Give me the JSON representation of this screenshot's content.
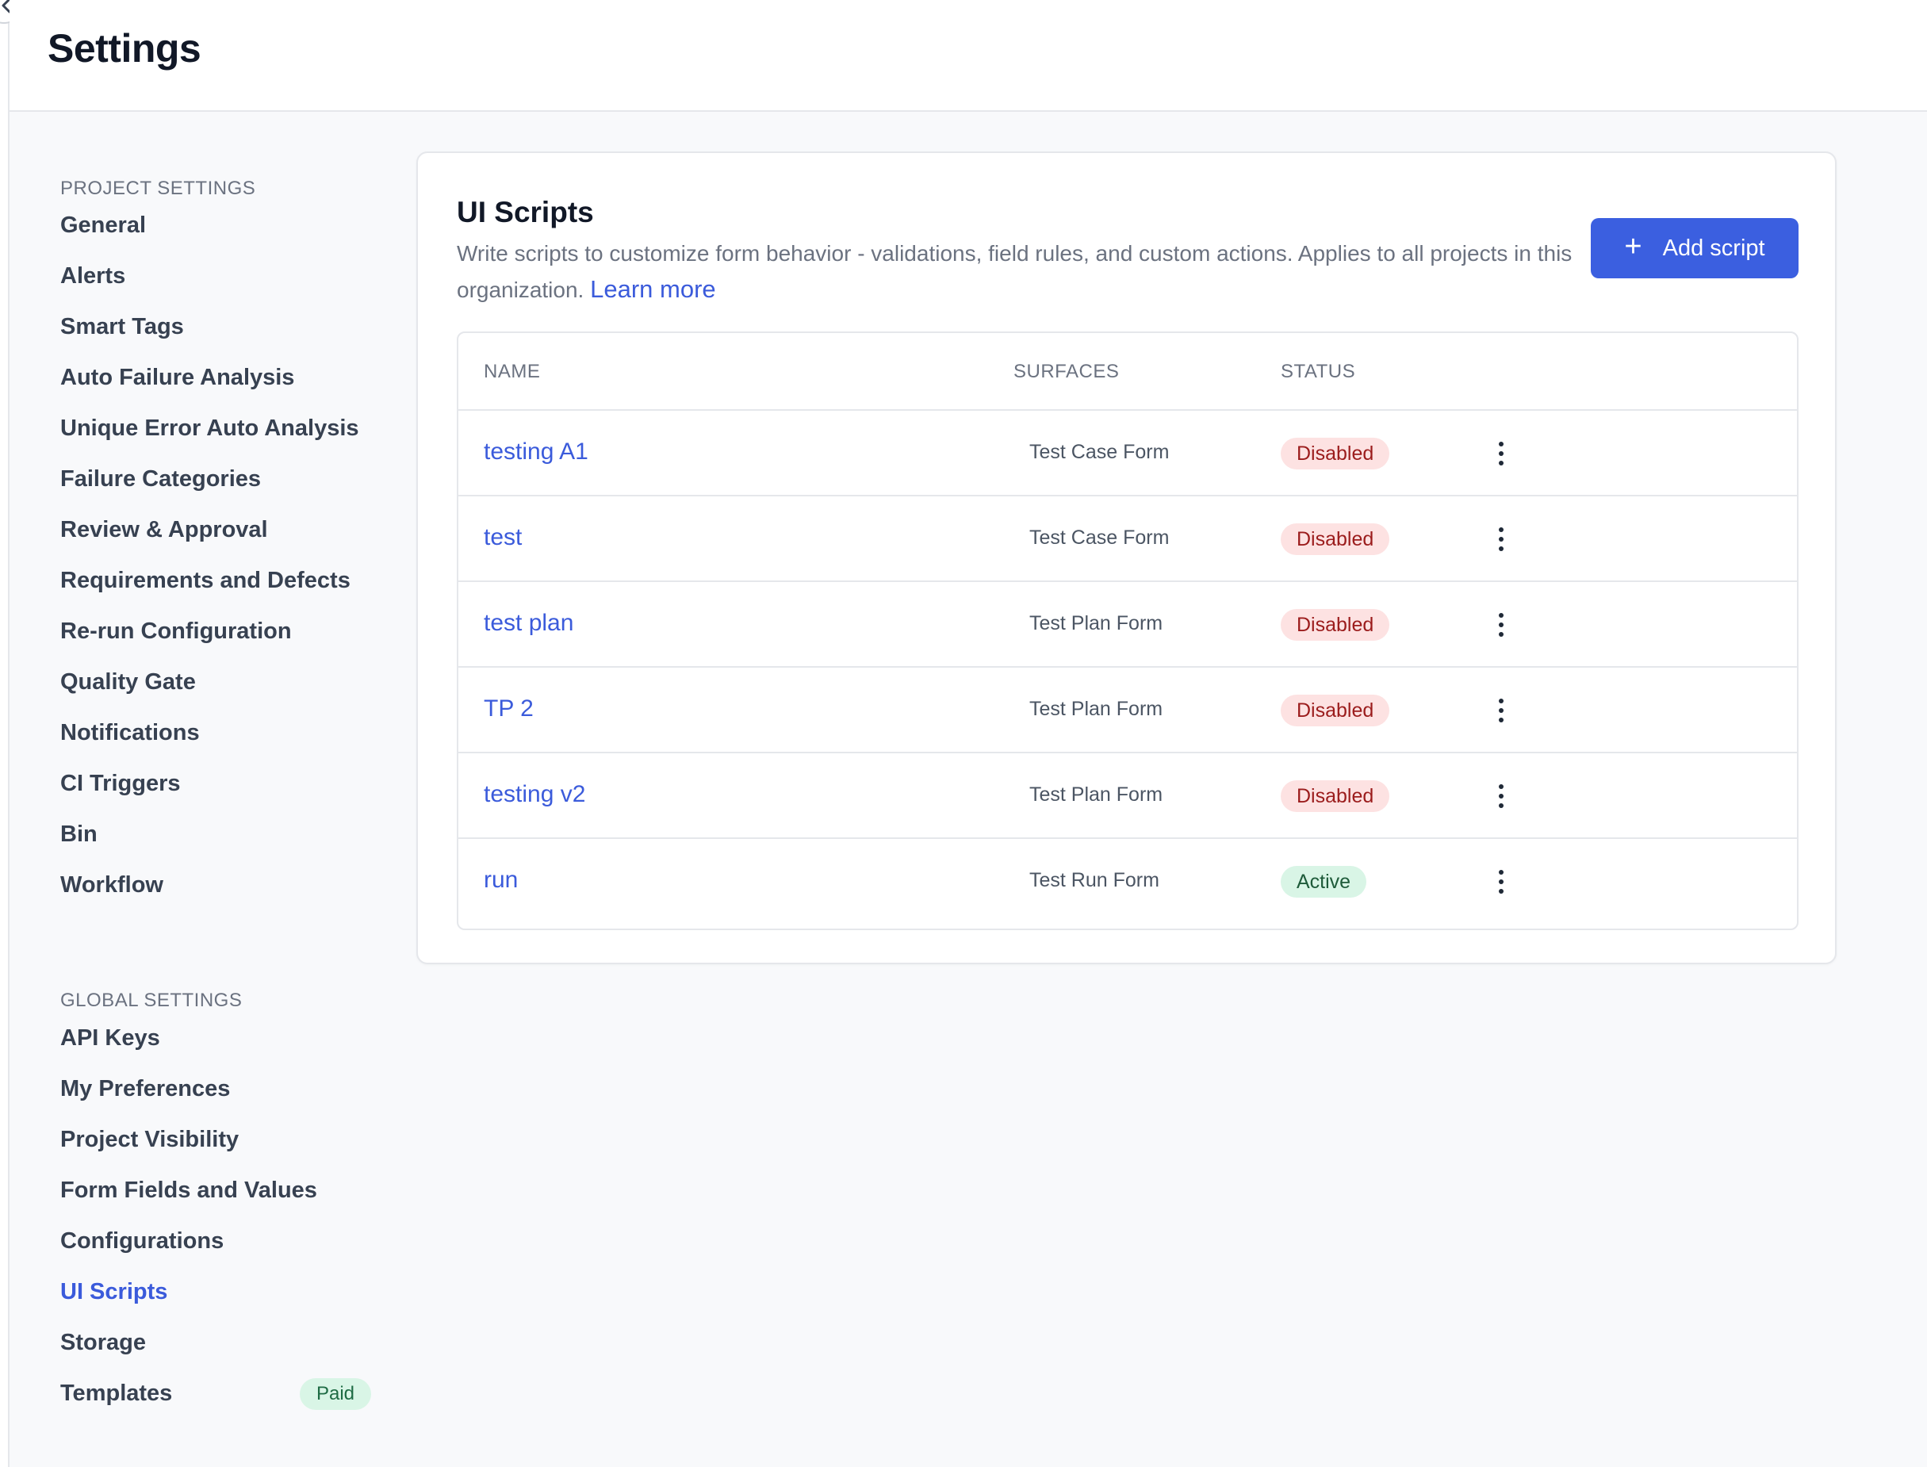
{
  "header": {
    "title": "Settings"
  },
  "sidebar": {
    "project_heading": "PROJECT SETTINGS",
    "project_items": [
      "General",
      "Alerts",
      "Smart Tags",
      "Auto Failure Analysis",
      "Unique Error Auto Analysis",
      "Failure Categories",
      "Review & Approval",
      "Requirements and Defects",
      "Re-run Configuration",
      "Quality Gate",
      "Notifications",
      "CI Triggers",
      "Bin",
      "Workflow"
    ],
    "global_heading": "GLOBAL SETTINGS",
    "global_items": [
      "API Keys",
      "My Preferences",
      "Project Visibility",
      "Form Fields and Values",
      "Configurations",
      "UI Scripts",
      "Storage",
      "Templates"
    ],
    "active_item": "UI Scripts",
    "templates_badge": "Paid"
  },
  "main": {
    "title": "UI Scripts",
    "description": "Write scripts to customize form behavior - validations, field rules, and custom actions. Applies to all projects in this organization.",
    "learn_more": "Learn more",
    "add_button": "Add script",
    "add_icon": "+",
    "table": {
      "columns": [
        "NAME",
        "SURFACES",
        "STATUS"
      ],
      "rows": [
        {
          "name": "testing A1",
          "surface": "Test Case Form",
          "status": "Disabled"
        },
        {
          "name": "test",
          "surface": "Test Case Form",
          "status": "Disabled"
        },
        {
          "name": "test plan",
          "surface": "Test Plan Form",
          "status": "Disabled"
        },
        {
          "name": "TP 2",
          "surface": "Test Plan Form",
          "status": "Disabled"
        },
        {
          "name": "testing v2",
          "surface": "Test Plan Form",
          "status": "Disabled"
        },
        {
          "name": "run",
          "surface": "Test Run Form",
          "status": "Active"
        }
      ]
    }
  },
  "icons": {
    "collapse": "chevron-left-icon",
    "row_menu": "more-vertical-icon",
    "add": "plus-icon"
  },
  "colors": {
    "accent": "#3b5fe0",
    "disabled_bg": "#fde2e2",
    "active_bg": "#d9f5e6"
  }
}
